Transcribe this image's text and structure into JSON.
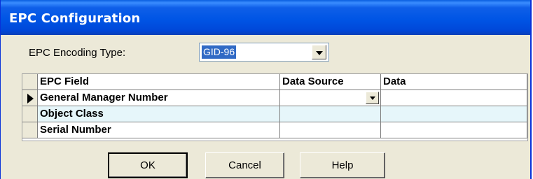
{
  "window": {
    "title": "EPC Configuration"
  },
  "encoding": {
    "label": "EPC Encoding Type:",
    "value": "GID-96"
  },
  "grid": {
    "columns": [
      "EPC Field",
      "Data Source",
      "Data"
    ],
    "rows": [
      {
        "field": "General Manager Number",
        "source": "",
        "data": ""
      },
      {
        "field": "Object Class",
        "source": "",
        "data": ""
      },
      {
        "field": "Serial Number",
        "source": "",
        "data": ""
      }
    ]
  },
  "buttons": {
    "ok": "OK",
    "cancel": "Cancel",
    "help": "Help"
  }
}
